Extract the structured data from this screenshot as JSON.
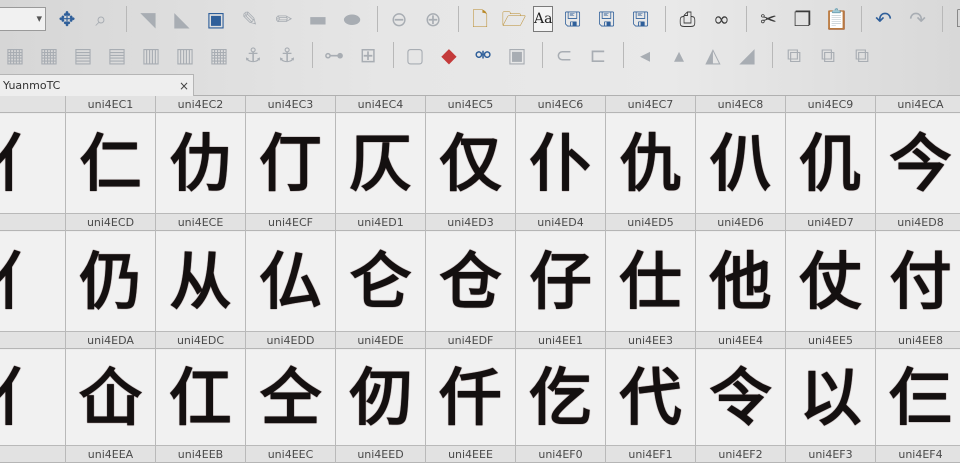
{
  "tab": {
    "title": "YuanmoTC",
    "close": "×"
  },
  "toolbar1": {
    "icons": [
      "magnify-icon",
      "triangle-icon",
      "flag-icon",
      "image-icon",
      "pen-icon",
      "pencil-icon",
      "rect-icon",
      "ellipse-icon",
      "arrow-left-icon",
      "arrow-right-icon",
      "new-file-icon",
      "open-folder-icon",
      "font-icon",
      "save-icon",
      "save-as-icon",
      "save-all-icon",
      "print-icon",
      "binoculars-icon",
      "cut-icon",
      "copy-icon",
      "paste-icon",
      "undo-icon",
      "redo-icon",
      "page-icon"
    ],
    "font_button": "Aa",
    "sort_button_top": "Z",
    "sort_button_bottom": "A"
  },
  "toolbar2": {
    "icons": [
      "table-icon",
      "table2-icon",
      "table3-icon",
      "table4-icon",
      "table5-icon",
      "grid-icon",
      "grid2-icon",
      "anchor-icon",
      "anchor-add-icon",
      "node-icon",
      "matrix-icon",
      "clipboard-icon",
      "eraser-icon",
      "unlink-icon",
      "glyph-icon",
      "hook-icon",
      "path-icon",
      "tri-left-icon",
      "tri-up-icon",
      "tri-tilt-icon",
      "tri-right-icon",
      "boolean-union-icon",
      "boolean-subtract-icon",
      "boolean-intersect-icon"
    ]
  },
  "glyph_rows": [
    {
      "cells": [
        {
          "name": "",
          "char": "亻"
        },
        {
          "name": "uni4EC1",
          "char": "仁"
        },
        {
          "name": "uni4EC2",
          "char": "仂"
        },
        {
          "name": "uni4EC3",
          "char": "仃"
        },
        {
          "name": "uni4EC4",
          "char": "仄"
        },
        {
          "name": "uni4EC5",
          "char": "仅"
        },
        {
          "name": "uni4EC6",
          "char": "仆"
        },
        {
          "name": "uni4EC7",
          "char": "仇"
        },
        {
          "name": "uni4EC8",
          "char": "仈"
        },
        {
          "name": "uni4EC9",
          "char": "仉"
        },
        {
          "name": "uni4ECA",
          "char": "今"
        }
      ]
    },
    {
      "cells": [
        {
          "name": "",
          "char": "亻"
        },
        {
          "name": "uni4ECD",
          "char": "仍"
        },
        {
          "name": "uni4ECE",
          "char": "从"
        },
        {
          "name": "uni4ECF",
          "char": "仏"
        },
        {
          "name": "uni4ED1",
          "char": "仑"
        },
        {
          "name": "uni4ED3",
          "char": "仓"
        },
        {
          "name": "uni4ED4",
          "char": "仔"
        },
        {
          "name": "uni4ED5",
          "char": "仕"
        },
        {
          "name": "uni4ED6",
          "char": "他"
        },
        {
          "name": "uni4ED7",
          "char": "仗"
        },
        {
          "name": "uni4ED8",
          "char": "付"
        }
      ]
    },
    {
      "cells": [
        {
          "name": "",
          "char": "亻"
        },
        {
          "name": "uni4EDA",
          "char": "仚"
        },
        {
          "name": "uni4EDC",
          "char": "仜"
        },
        {
          "name": "uni4EDD",
          "char": "仝"
        },
        {
          "name": "uni4EDE",
          "char": "仞"
        },
        {
          "name": "uni4EDF",
          "char": "仟"
        },
        {
          "name": "uni4EE1",
          "char": "仡"
        },
        {
          "name": "uni4EE3",
          "char": "代"
        },
        {
          "name": "uni4EE4",
          "char": "令"
        },
        {
          "name": "uni4EE5",
          "char": "以"
        },
        {
          "name": "uni4EE8",
          "char": "仨"
        }
      ]
    },
    {
      "cells": [
        {
          "name": "",
          "char": ""
        },
        {
          "name": "uni4EEA",
          "char": ""
        },
        {
          "name": "uni4EEB",
          "char": ""
        },
        {
          "name": "uni4EEC",
          "char": ""
        },
        {
          "name": "uni4EED",
          "char": ""
        },
        {
          "name": "uni4EEE",
          "char": ""
        },
        {
          "name": "uni4EF0",
          "char": ""
        },
        {
          "name": "uni4EF1",
          "char": ""
        },
        {
          "name": "uni4EF2",
          "char": ""
        },
        {
          "name": "uni4EF3",
          "char": ""
        },
        {
          "name": "uni4EF4",
          "char": ""
        }
      ]
    }
  ]
}
